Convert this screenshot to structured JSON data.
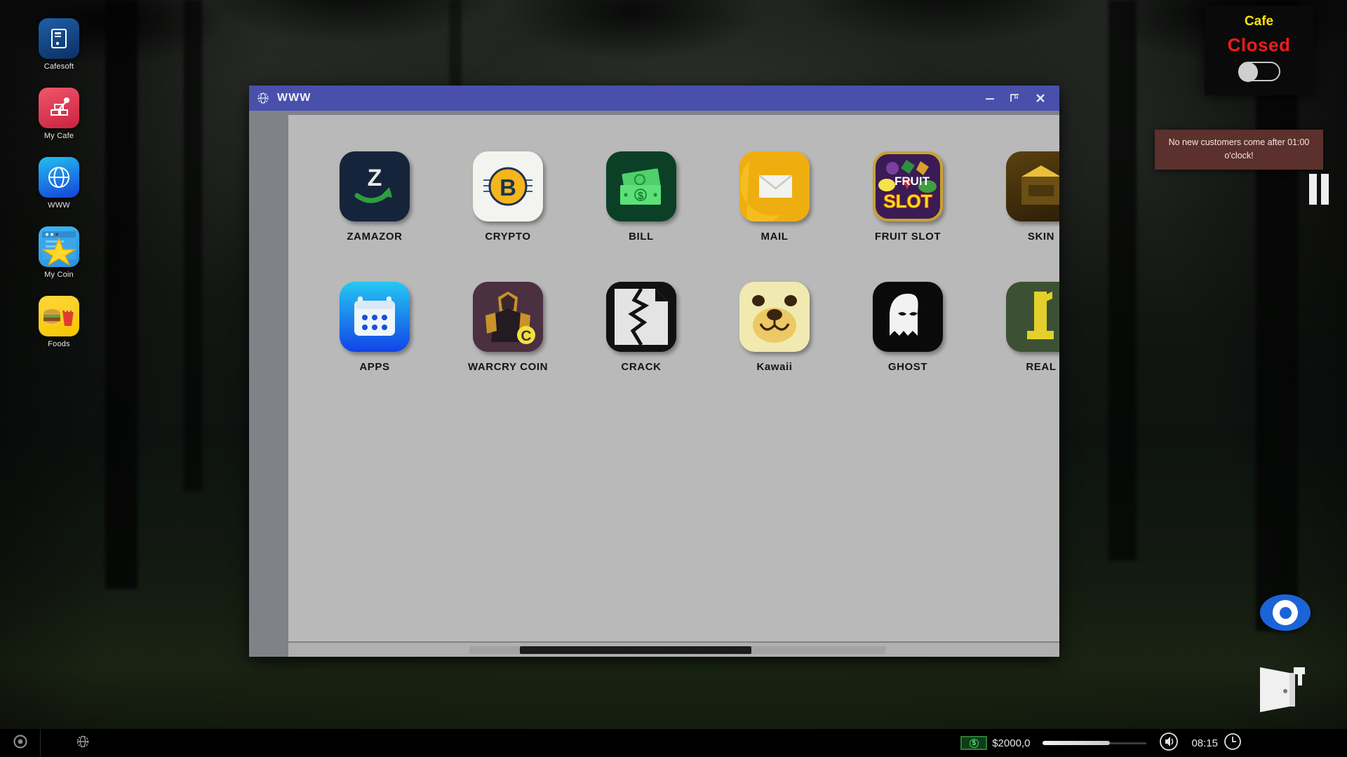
{
  "desktop": {
    "icons": [
      {
        "label": "Cafesoft",
        "icon": "pc-tower-icon",
        "theme": "ic-cafesoft"
      },
      {
        "label": "My Cafe",
        "icon": "build-hammer-icon",
        "theme": "ic-mycafe"
      },
      {
        "label": "WWW",
        "icon": "globe-icon",
        "theme": "ic-www"
      },
      {
        "label": "My Coin",
        "icon": "star-window-icon",
        "theme": "ic-mycoin"
      },
      {
        "label": "Foods",
        "icon": "burger-fries-icon",
        "theme": "ic-foods"
      }
    ]
  },
  "window": {
    "title": "WWW",
    "title_icon": "globe-icon",
    "controls": {
      "minimize": "minimize-button",
      "maximize": "maximize-button",
      "close": "close-button"
    },
    "apps": [
      {
        "label": "ZAMAZOR",
        "icon": "zamazor-z-arrow-icon",
        "theme": "t-zamazor"
      },
      {
        "label": "CRYPTO",
        "icon": "bitcoin-coin-icon",
        "theme": "t-crypto"
      },
      {
        "label": "BILL",
        "icon": "dollar-bills-icon",
        "theme": "t-bill"
      },
      {
        "label": "MAIL",
        "icon": "envelope-icon",
        "theme": "t-mail"
      },
      {
        "label": "FRUIT SLOT",
        "icon": "fruit-slot-machine-icon",
        "theme": "t-fruit"
      },
      {
        "label": "SKIN",
        "icon": "skin-crate-icon",
        "theme": "t-skin"
      },
      {
        "label": "APPS",
        "icon": "calendar-apps-icon",
        "theme": "t-apps"
      },
      {
        "label": "WARCRY COIN",
        "icon": "warrior-coin-icon",
        "theme": "t-warcry"
      },
      {
        "label": "CRACK",
        "icon": "cracked-page-icon",
        "theme": "t-crack"
      },
      {
        "label": "Kawaii",
        "icon": "bear-face-icon",
        "theme": "t-kawaii"
      },
      {
        "label": "GHOST",
        "icon": "ghost-icon",
        "theme": "t-ghost"
      },
      {
        "label": "REAL",
        "icon": "gold-statue-icon",
        "theme": "t-real"
      }
    ]
  },
  "cafe_status": {
    "title": "Cafe",
    "state": "Closed",
    "state_color": "#f01c1c",
    "title_color": "#ffe500",
    "toggle_on": false
  },
  "tooltip": {
    "text": "No new customers come after 01:00 o'clock!"
  },
  "taskbar": {
    "start_icon": "power-start-icon",
    "www_icon": "globe-icon",
    "money": "$2000,0",
    "money_icon": "money-bill-icon",
    "volume_icon": "speaker-icon",
    "volume_percent": 65,
    "clock": "08:15",
    "clock_icon": "clock-icon"
  },
  "overlay": {
    "pause_label": "pause-button",
    "eye_label": "view-toggle-button",
    "exit_label": "exit-door-button"
  }
}
